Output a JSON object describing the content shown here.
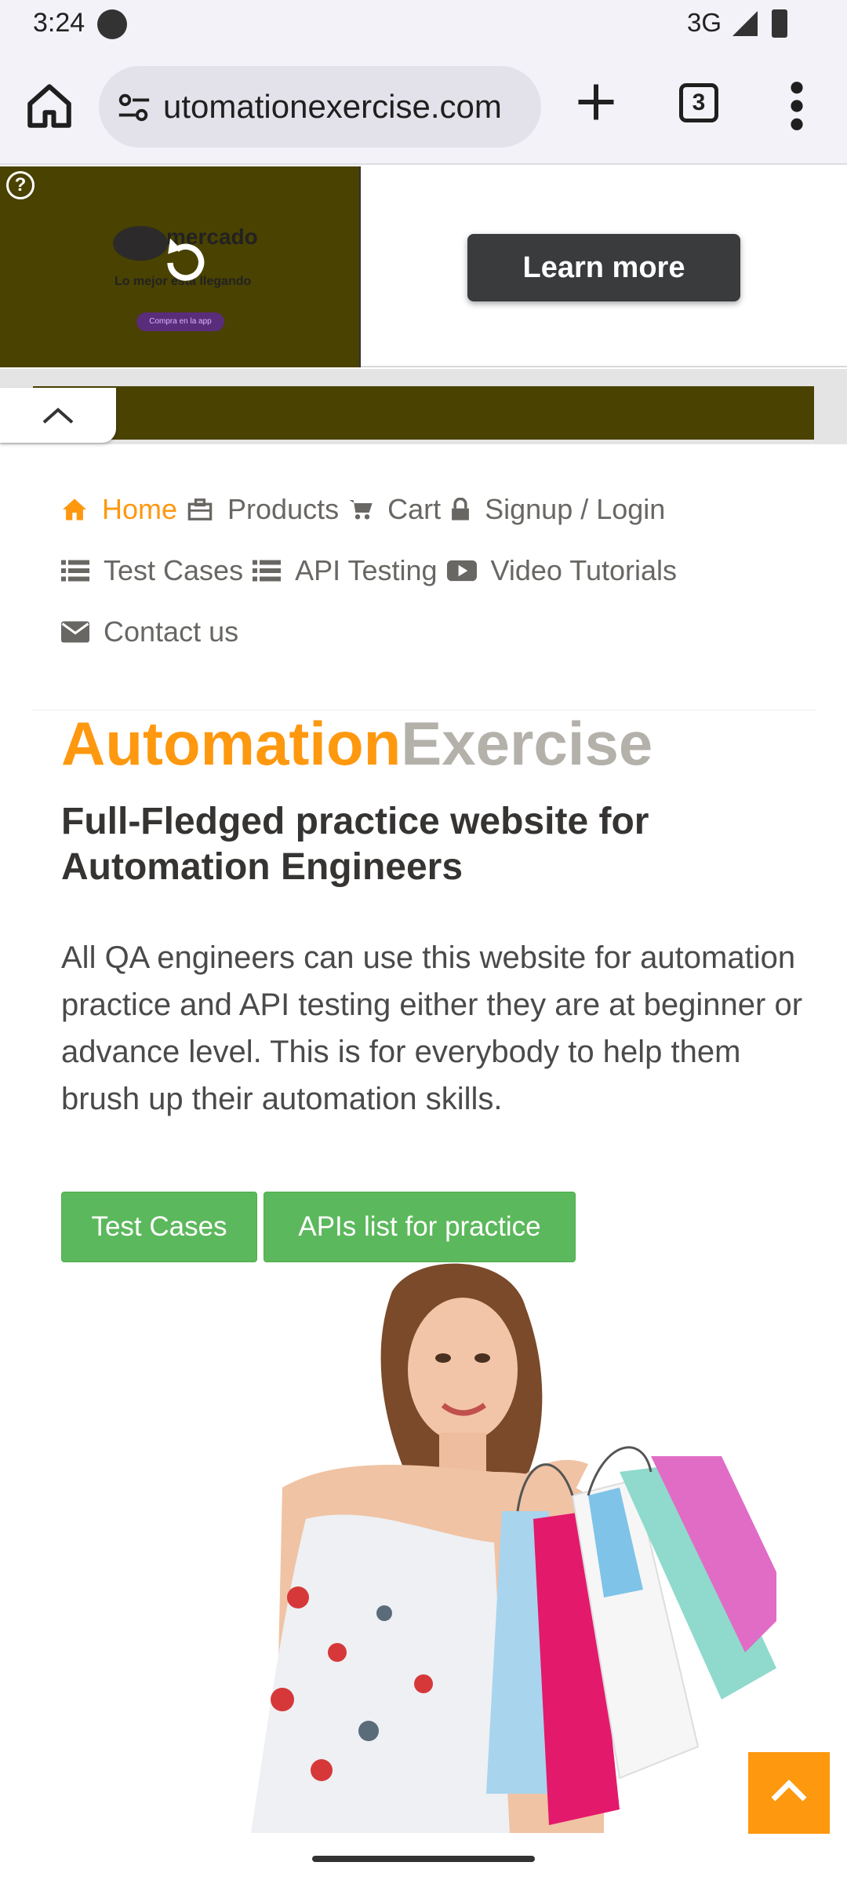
{
  "status_bar": {
    "time": "3:24",
    "network": "3G"
  },
  "browser": {
    "url_text": "utomationexercise.com",
    "tab_count": "3"
  },
  "ad": {
    "brand_text": "mercado",
    "tagline": "Lo mejor está llegando",
    "small_cta": "Compra en la app",
    "learn_more_label": "Learn more",
    "help_glyph": "?"
  },
  "nav": {
    "home": "Home",
    "products": "Products",
    "cart": "Cart",
    "signup_login": "Signup / Login",
    "test_cases": "Test Cases",
    "api_testing": "API Testing",
    "video_tutorials": "Video Tutorials",
    "contact_us": "Contact us"
  },
  "hero": {
    "brand_part1": "Automation",
    "brand_part2": "Exercise",
    "heading": "Full-Fledged practice website for Automation Engineers",
    "description": "All QA engineers can use this website for automation practice and API testing either they are at beginner or advance level. This is for everybody to help them brush up their automation skills.",
    "btn_test_cases": "Test Cases",
    "btn_apis": "APIs list for practice"
  },
  "colors": {
    "accent": "#FE980F",
    "brand_grey": "#B4B1AB",
    "button_green": "#5cb85c",
    "ad_bg": "#4a4200"
  }
}
